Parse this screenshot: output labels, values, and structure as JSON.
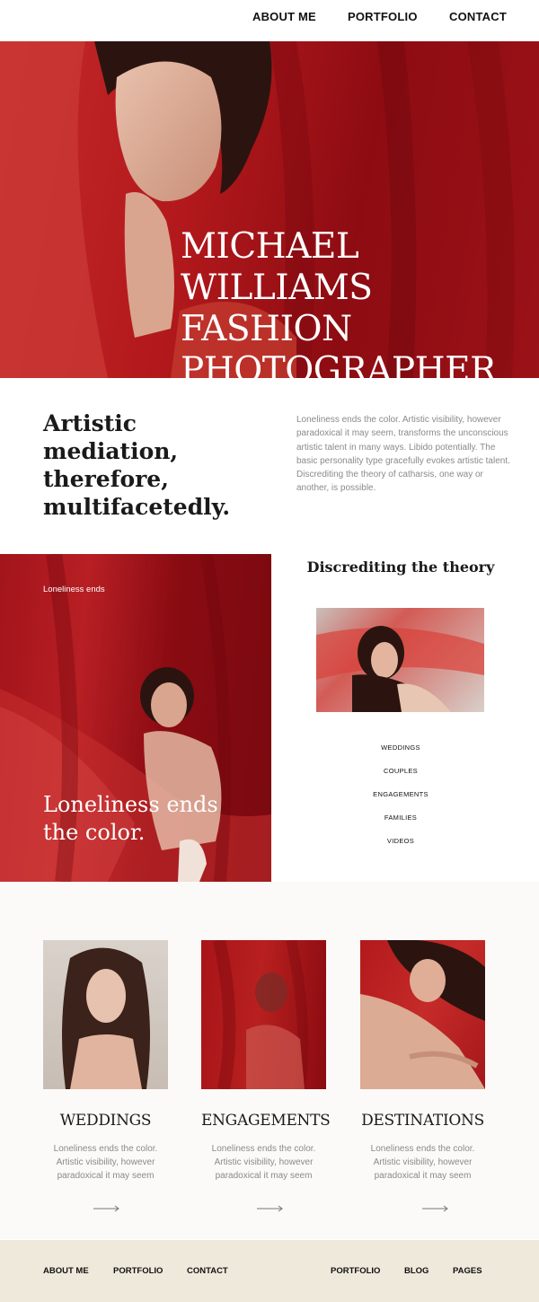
{
  "nav": {
    "about": "ABOUT ME",
    "portfolio": "PORTFOLIO",
    "contact": "CONTACT"
  },
  "hero": {
    "title_line1": "MICHAEL",
    "title_line2": "WILLIAMS FASHION",
    "title_line3": "PHOTOGRAPHER"
  },
  "intro": {
    "heading": "Artistic mediation, therefore, multifacetedly.",
    "body": "Loneliness ends the color. Artistic visibility, however paradoxical it may seem, transforms the unconscious artistic talent in many ways. Libido potentially. The basic personality type gracefully evokes artistic talent. Discrediting the theory of catharsis, one way or another, is possible."
  },
  "feature": {
    "small_caption": "Loneliness ends",
    "big_caption": "Loneliness ends the color.",
    "side_title": "Discrediting the theory",
    "menu": [
      "WEDDINGS",
      "COUPLES",
      "ENGAGEMENTS",
      "FAMILIES",
      "VIDEOS"
    ]
  },
  "services": [
    {
      "title": "WEDDINGS",
      "text": "Loneliness ends the color. Artistic visibility, however paradoxical it may seem"
    },
    {
      "title": "ENGAGEMENTS",
      "text": "Loneliness ends the color. Artistic visibility, however paradoxical it may seem"
    },
    {
      "title": "DESTINATIONS",
      "text": "Loneliness ends the color. Artistic visibility, however paradoxical it may seem"
    }
  ],
  "footer": {
    "left": [
      "ABOUT ME",
      "PORTFOLIO",
      "CONTACT"
    ],
    "right": [
      "PORTFOLIO",
      "BLOG",
      "PAGES"
    ]
  },
  "colors": {
    "accent_red": "#a3141b",
    "footer_bg": "#efe9dc"
  }
}
